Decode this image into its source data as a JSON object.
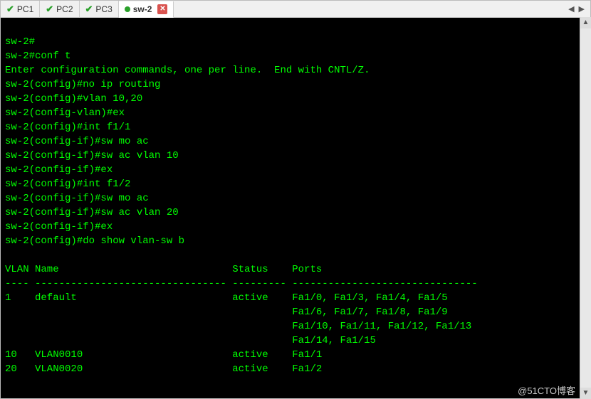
{
  "tabs": [
    {
      "label": "PC1",
      "icon": "check",
      "active": false
    },
    {
      "label": "PC2",
      "icon": "check",
      "active": false
    },
    {
      "label": "PC3",
      "icon": "check",
      "active": false
    },
    {
      "label": "sw-2",
      "icon": "dot",
      "active": true
    }
  ],
  "watermark": "@51CTO博客",
  "terminal": {
    "lines": [
      "sw-2#",
      "sw-2#conf t",
      "Enter configuration commands, one per line.  End with CNTL/Z.",
      "sw-2(config)#no ip routing",
      "sw-2(config)#vlan 10,20",
      "sw-2(config-vlan)#ex",
      "sw-2(config)#int f1/1",
      "sw-2(config-if)#sw mo ac",
      "sw-2(config-if)#sw ac vlan 10",
      "sw-2(config-if)#ex",
      "sw-2(config)#int f1/2",
      "sw-2(config-if)#sw mo ac",
      "sw-2(config-if)#sw ac vlan 20",
      "sw-2(config-if)#ex",
      "sw-2(config)#do show vlan-sw b",
      "",
      "VLAN Name                             Status    Ports",
      "---- -------------------------------- --------- -------------------------------",
      "1    default                          active    Fa1/0, Fa1/3, Fa1/4, Fa1/5",
      "                                                Fa1/6, Fa1/7, Fa1/8, Fa1/9",
      "                                                Fa1/10, Fa1/11, Fa1/12, Fa1/13",
      "                                                Fa1/14, Fa1/15",
      "10   VLAN0010                         active    Fa1/1",
      "20   VLAN0020                         active    Fa1/2"
    ],
    "vlan_table": {
      "columns": [
        "VLAN",
        "Name",
        "Status",
        "Ports"
      ],
      "rows": [
        {
          "vlan": "1",
          "name": "default",
          "status": "active",
          "ports": [
            "Fa1/0",
            "Fa1/3",
            "Fa1/4",
            "Fa1/5",
            "Fa1/6",
            "Fa1/7",
            "Fa1/8",
            "Fa1/9",
            "Fa1/10",
            "Fa1/11",
            "Fa1/12",
            "Fa1/13",
            "Fa1/14",
            "Fa1/15"
          ]
        },
        {
          "vlan": "10",
          "name": "VLAN0010",
          "status": "active",
          "ports": [
            "Fa1/1"
          ]
        },
        {
          "vlan": "20",
          "name": "VLAN0020",
          "status": "active",
          "ports": [
            "Fa1/2"
          ]
        }
      ]
    }
  }
}
